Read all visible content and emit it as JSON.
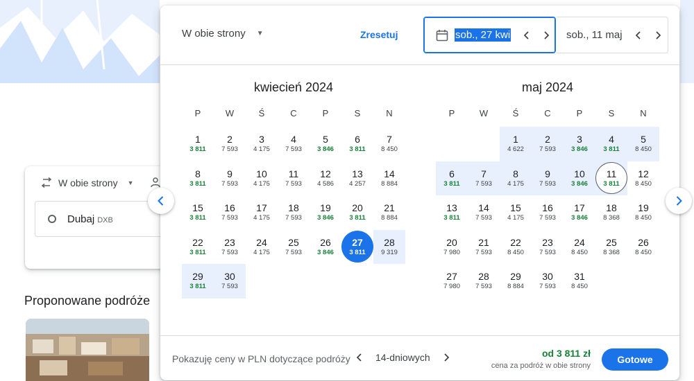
{
  "background": {
    "search": {
      "trip_type": "W obie strony",
      "origin_city": "Dubaj",
      "origin_code": "DXB"
    },
    "suggestions_title": "Proponowane podróże"
  },
  "picker": {
    "trip_type": "W obie strony",
    "reset_label": "Zresetuj",
    "departure": "sob., 27 kwi",
    "return": "sob., 11 maj",
    "months": [
      {
        "title": "kwiecień 2024",
        "weekdays": [
          "P",
          "W",
          "Ś",
          "C",
          "P",
          "S",
          "N"
        ],
        "offset": 0,
        "days": [
          {
            "d": "1",
            "p": "3 811",
            "c": true
          },
          {
            "d": "2",
            "p": "7 593"
          },
          {
            "d": "3",
            "p": "4 175"
          },
          {
            "d": "4",
            "p": "7 593"
          },
          {
            "d": "5",
            "p": "3 846",
            "c": true
          },
          {
            "d": "6",
            "p": "3 811",
            "c": true
          },
          {
            "d": "7",
            "p": "8 450"
          },
          {
            "d": "8",
            "p": "3 811",
            "c": true
          },
          {
            "d": "9",
            "p": "7 593"
          },
          {
            "d": "10",
            "p": "4 175"
          },
          {
            "d": "11",
            "p": "7 593"
          },
          {
            "d": "12",
            "p": "4 586"
          },
          {
            "d": "13",
            "p": "4 257"
          },
          {
            "d": "14",
            "p": "8 884"
          },
          {
            "d": "15",
            "p": "3 811",
            "c": true
          },
          {
            "d": "16",
            "p": "7 593"
          },
          {
            "d": "17",
            "p": "4 175"
          },
          {
            "d": "18",
            "p": "7 593"
          },
          {
            "d": "19",
            "p": "3 846",
            "c": true
          },
          {
            "d": "20",
            "p": "3 811",
            "c": true
          },
          {
            "d": "21",
            "p": "8 884"
          },
          {
            "d": "22",
            "p": "3 811",
            "c": true
          },
          {
            "d": "23",
            "p": "7 593"
          },
          {
            "d": "24",
            "p": "4 175"
          },
          {
            "d": "25",
            "p": "7 593"
          },
          {
            "d": "26",
            "p": "3 846",
            "c": true
          },
          {
            "d": "27",
            "p": "3 811",
            "c": true,
            "state": "sel"
          },
          {
            "d": "28",
            "p": "9 319",
            "state": "range"
          },
          {
            "d": "29",
            "p": "3 811",
            "c": true,
            "state": "range"
          },
          {
            "d": "30",
            "p": "7 593",
            "state": "range"
          }
        ]
      },
      {
        "title": "maj 2024",
        "weekdays": [
          "P",
          "W",
          "Ś",
          "C",
          "P",
          "S",
          "N"
        ],
        "offset": 2,
        "days": [
          {
            "d": "1",
            "p": "4 622",
            "state": "range"
          },
          {
            "d": "2",
            "p": "7 593",
            "state": "range"
          },
          {
            "d": "3",
            "p": "3 846",
            "c": true,
            "state": "range"
          },
          {
            "d": "4",
            "p": "3 811",
            "c": true,
            "state": "range"
          },
          {
            "d": "5",
            "p": "8 450",
            "state": "range"
          },
          {
            "d": "6",
            "p": "3 811",
            "c": true,
            "state": "range"
          },
          {
            "d": "7",
            "p": "7 593",
            "state": "range"
          },
          {
            "d": "8",
            "p": "4 175",
            "state": "range"
          },
          {
            "d": "9",
            "p": "7 593",
            "state": "range"
          },
          {
            "d": "10",
            "p": "3 846",
            "c": true,
            "state": "range"
          },
          {
            "d": "11",
            "p": "3 811",
            "c": true,
            "state": "end"
          },
          {
            "d": "12",
            "p": "8 450"
          },
          {
            "d": "13",
            "p": "3 811",
            "c": true
          },
          {
            "d": "14",
            "p": "7 593"
          },
          {
            "d": "15",
            "p": "4 175"
          },
          {
            "d": "16",
            "p": "7 593"
          },
          {
            "d": "17",
            "p": "3 846",
            "c": true
          },
          {
            "d": "18",
            "p": "8 368"
          },
          {
            "d": "19",
            "p": "8 450"
          },
          {
            "d": "20",
            "p": "7 980"
          },
          {
            "d": "21",
            "p": "7 593"
          },
          {
            "d": "22",
            "p": "8 450"
          },
          {
            "d": "23",
            "p": "7 593"
          },
          {
            "d": "24",
            "p": "8 450"
          },
          {
            "d": "25",
            "p": "8 368"
          },
          {
            "d": "26",
            "p": "8 450"
          },
          {
            "d": "27",
            "p": "7 980"
          },
          {
            "d": "28",
            "p": "7 593"
          },
          {
            "d": "29",
            "p": "8 884"
          },
          {
            "d": "30",
            "p": "7 593"
          },
          {
            "d": "31",
            "p": "8 450"
          }
        ]
      }
    ],
    "footer": {
      "info": "Pokazuję ceny w PLN dotyczące podróży",
      "duration": "14-dniowych",
      "price_from": "od 3 811 zł",
      "price_sub": "cena za podróż w obie strony",
      "done_label": "Gotowe"
    }
  },
  "colors": {
    "accent": "#1a73e8",
    "cheap": "#188038",
    "range": "#e8f0fe"
  }
}
